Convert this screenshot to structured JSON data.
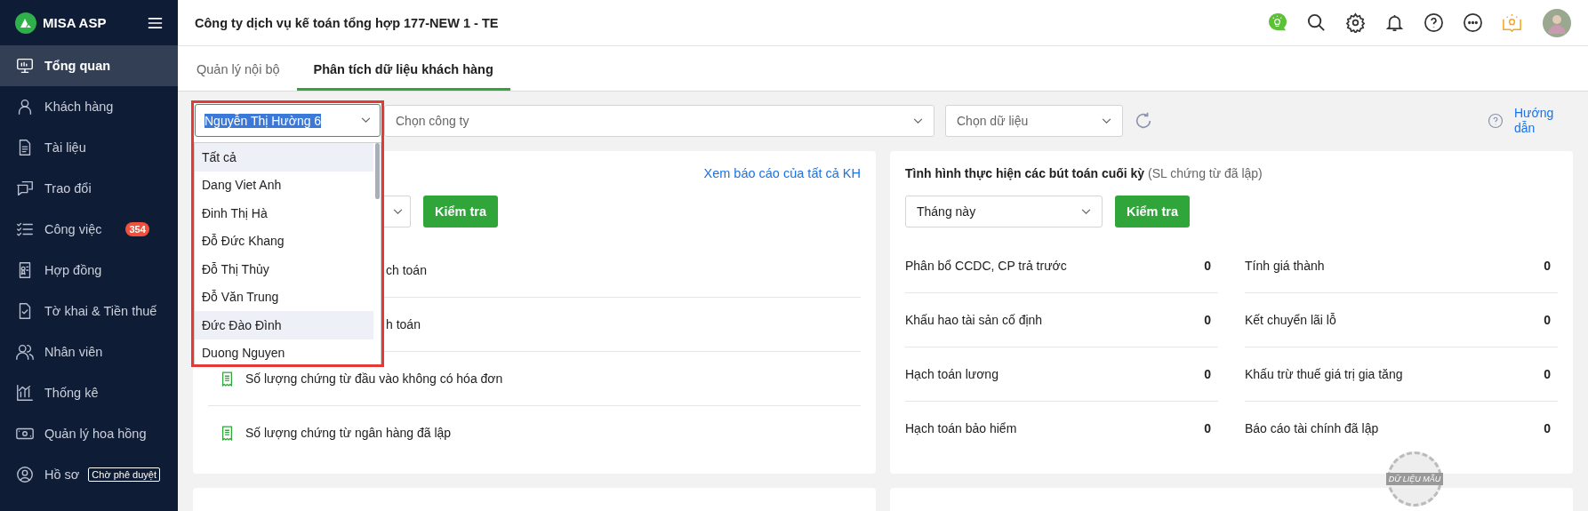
{
  "sidebar": {
    "logo": "MISA ASP",
    "items": [
      {
        "label": "Tổng quan",
        "selected": true
      },
      {
        "label": "Khách hàng",
        "selected": false
      },
      {
        "label": "Tài liệu",
        "selected": false
      },
      {
        "label": "Trao đổi",
        "selected": false
      },
      {
        "label": "Công việc",
        "selected": false,
        "badge": "354"
      },
      {
        "label": "Hợp đồng",
        "selected": false
      },
      {
        "label": "Tờ khai & Tiền thuế",
        "selected": false
      },
      {
        "label": "Nhân viên",
        "selected": false
      },
      {
        "label": "Thống kê",
        "selected": false
      },
      {
        "label": "Quản lý hoa hồng",
        "selected": false
      },
      {
        "label": "Hồ sơ",
        "selected": false,
        "tag": "Chờ phê duyệt"
      }
    ]
  },
  "header": {
    "title": "Công ty dịch vụ kế toán tổng hợp 177-NEW 1 - TE"
  },
  "tabs": [
    {
      "label": "Quản lý nội bộ",
      "selected": false
    },
    {
      "label": "Phân tích dữ liệu khách hàng",
      "selected": true
    }
  ],
  "filters": {
    "company_select": {
      "placeholder": "Chọn công ty"
    },
    "data_select": {
      "placeholder": "Chọn dữ liệu"
    },
    "guide_link": "Hướng dẫn"
  },
  "customer_dropdown": {
    "value": "Nguyễn Thị Hường 6",
    "options": [
      {
        "label": "Tất cả",
        "highlighted": true
      },
      {
        "label": "Dang Viet Anh",
        "highlighted": false
      },
      {
        "label": "Đinh Thị Hà",
        "highlighted": false
      },
      {
        "label": "Đỗ Đức Khang",
        "highlighted": false
      },
      {
        "label": "Đỗ Thị Thủy",
        "highlighted": false
      },
      {
        "label": "Đỗ Văn Trung",
        "highlighted": false
      },
      {
        "label": "Đức Đào Đình",
        "highlighted": true
      },
      {
        "label": "Duong Nguyen",
        "highlighted": false
      }
    ]
  },
  "left_card": {
    "link": "Xem báo cáo của tất cả KH",
    "button": "Kiểm tra",
    "rows": [
      {
        "kind": "covered",
        "label": "ch toán"
      },
      {
        "kind": "covered",
        "label": "h toán"
      },
      {
        "kind": "full",
        "label": "Số lượng chứng từ đầu vào không có hóa đơn"
      },
      {
        "kind": "full",
        "label": "Số lượng chứng từ ngân hàng đã lập"
      }
    ]
  },
  "right_card": {
    "title": "Tình hình thực hiện các bút toán cuối kỳ",
    "subtitle": "(SL chứng từ đã lập)",
    "period": "Tháng này",
    "button": "Kiểm tra",
    "rows": [
      [
        {
          "label": "Phân bổ CCDC, CP trả trước",
          "value": "0"
        },
        {
          "label": "Tính giá thành",
          "value": "0"
        }
      ],
      [
        {
          "label": "Khấu hao tài sản cố định",
          "value": "0"
        },
        {
          "label": "Kết chuyển lãi lỗ",
          "value": "0"
        }
      ],
      [
        {
          "label": "Hạch toán lương",
          "value": "0"
        },
        {
          "label": "Khấu trừ thuế giá trị gia tăng",
          "value": "0"
        }
      ],
      [
        {
          "label": "Hạch toán bảo hiểm",
          "value": "0"
        },
        {
          "label": "Báo cáo tài chính đã lập",
          "value": "0"
        }
      ]
    ]
  },
  "stamp": "DỮ LIỆU MẪU"
}
